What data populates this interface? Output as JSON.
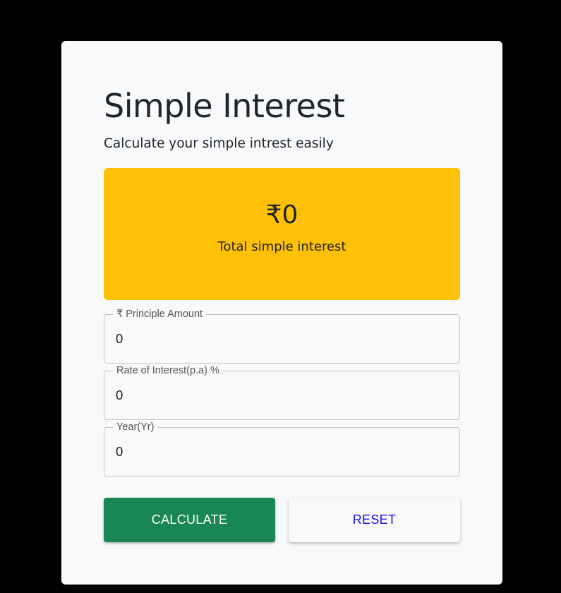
{
  "header": {
    "title": "Simple Interest",
    "subtitle": "Calculate your simple intrest easily"
  },
  "result": {
    "amount": "₹0",
    "label": "Total simple interest"
  },
  "fields": [
    {
      "label": "₹ Principle Amount",
      "value": "0"
    },
    {
      "label": "Rate of Interest(p.a) %",
      "value": "0"
    },
    {
      "label": "Year(Yr)",
      "value": "0"
    }
  ],
  "buttons": {
    "calculate_label": "CALCULATE",
    "reset_label": "RESET"
  },
  "colors": {
    "page_background": "#000000",
    "card_background": "#f8f9fa",
    "result_background": "#ffc107",
    "calculate_background": "#198754",
    "reset_text": "#1a12e0"
  }
}
